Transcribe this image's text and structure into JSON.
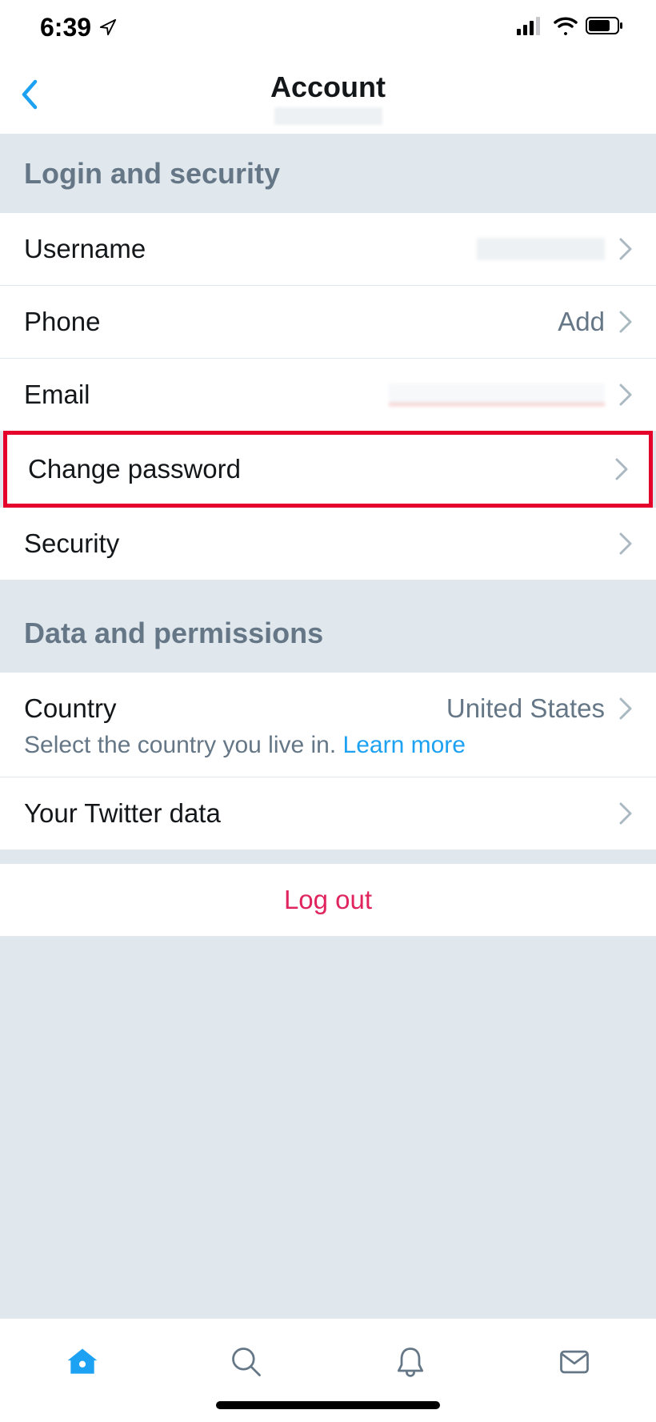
{
  "statusBar": {
    "time": "6:39"
  },
  "header": {
    "title": "Account"
  },
  "sections": {
    "login": {
      "title": "Login and security",
      "rows": {
        "username": {
          "label": "Username"
        },
        "phone": {
          "label": "Phone",
          "value": "Add"
        },
        "email": {
          "label": "Email"
        },
        "changePassword": {
          "label": "Change password"
        },
        "security": {
          "label": "Security"
        }
      }
    },
    "data": {
      "title": "Data and permissions",
      "rows": {
        "country": {
          "label": "Country",
          "value": "United States",
          "description": "Select the country you live in. ",
          "learnMore": "Learn more"
        },
        "twitterData": {
          "label": "Your Twitter data"
        }
      }
    }
  },
  "logout": {
    "label": "Log out"
  }
}
